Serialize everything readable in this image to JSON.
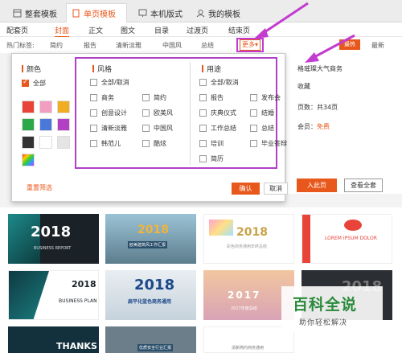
{
  "tabs": [
    {
      "label": "整套模板",
      "active": false
    },
    {
      "label": "单页模板",
      "active": true
    },
    {
      "label": "本机版式",
      "active": false
    },
    {
      "label": "我的模板",
      "active": false
    }
  ],
  "subnav": [
    "配套页",
    "封面",
    "正文",
    "图文",
    "目录",
    "过渡页",
    "结束页"
  ],
  "tagbar": {
    "prefix": "热门标签:",
    "tags": [
      "简约",
      "报告",
      "清新淡雅",
      "中国风",
      "总结"
    ],
    "more": "更多",
    "hot": "最热",
    "newest": "最新"
  },
  "side": {
    "title": "格璀璨大气商务",
    "fav": "收藏",
    "pages": "页数：共34页",
    "member_label": "会员：",
    "member_value": "免费",
    "insert": "入此页",
    "view_all": "查看全套"
  },
  "panel": {
    "color_title": "颜色",
    "color_all": "全部",
    "swatches": [
      "#e8443a",
      "#f29ec0",
      "#f0ad22",
      "#2aa84a",
      "#4a78d8",
      "#b23fc4",
      "#333333",
      "#ffffff",
      "#e5e5e5",
      "rainbow"
    ],
    "style_title": "风格",
    "style_items": [
      "全部/取消",
      "商务",
      "简约",
      "创意设计",
      "欧美风",
      "清新淡雅",
      "中国风",
      "韩范儿",
      "酷炫"
    ],
    "use_title": "用途",
    "use_items": [
      "全部/取消",
      "报告",
      "发布会",
      "庆典仪式",
      "结婚",
      "工作总结",
      "总结",
      "培训",
      "毕业答辩",
      "简历"
    ],
    "reset": "重置筛选",
    "ok": "确认",
    "cancel": "取消"
  },
  "thumbs": [
    {
      "big": "2018",
      "small": "BUSINESS REPORT"
    },
    {
      "big": "2018",
      "small": "欧美建筑风工作汇报"
    },
    {
      "big": "2018",
      "small": "彩色商务通用年终总结"
    },
    {
      "big": "",
      "small": "LOREM IPSUM DOLOR"
    },
    {
      "big": "2018",
      "small": "BUSINESS PLAN"
    },
    {
      "big": "2018",
      "small": "扁平化蓝色商务通用"
    },
    {
      "big": "2017",
      "small": "2017年度总结"
    },
    {
      "big": "2018",
      "small": ""
    },
    {
      "big": "THANKS",
      "small": ""
    },
    {
      "big": "",
      "small": "优质安全行业汇报"
    },
    {
      "big": "",
      "small": "清新简约商务通用"
    }
  ],
  "watermark": {
    "title": "百科全说",
    "sub": "助你轻松解决"
  }
}
